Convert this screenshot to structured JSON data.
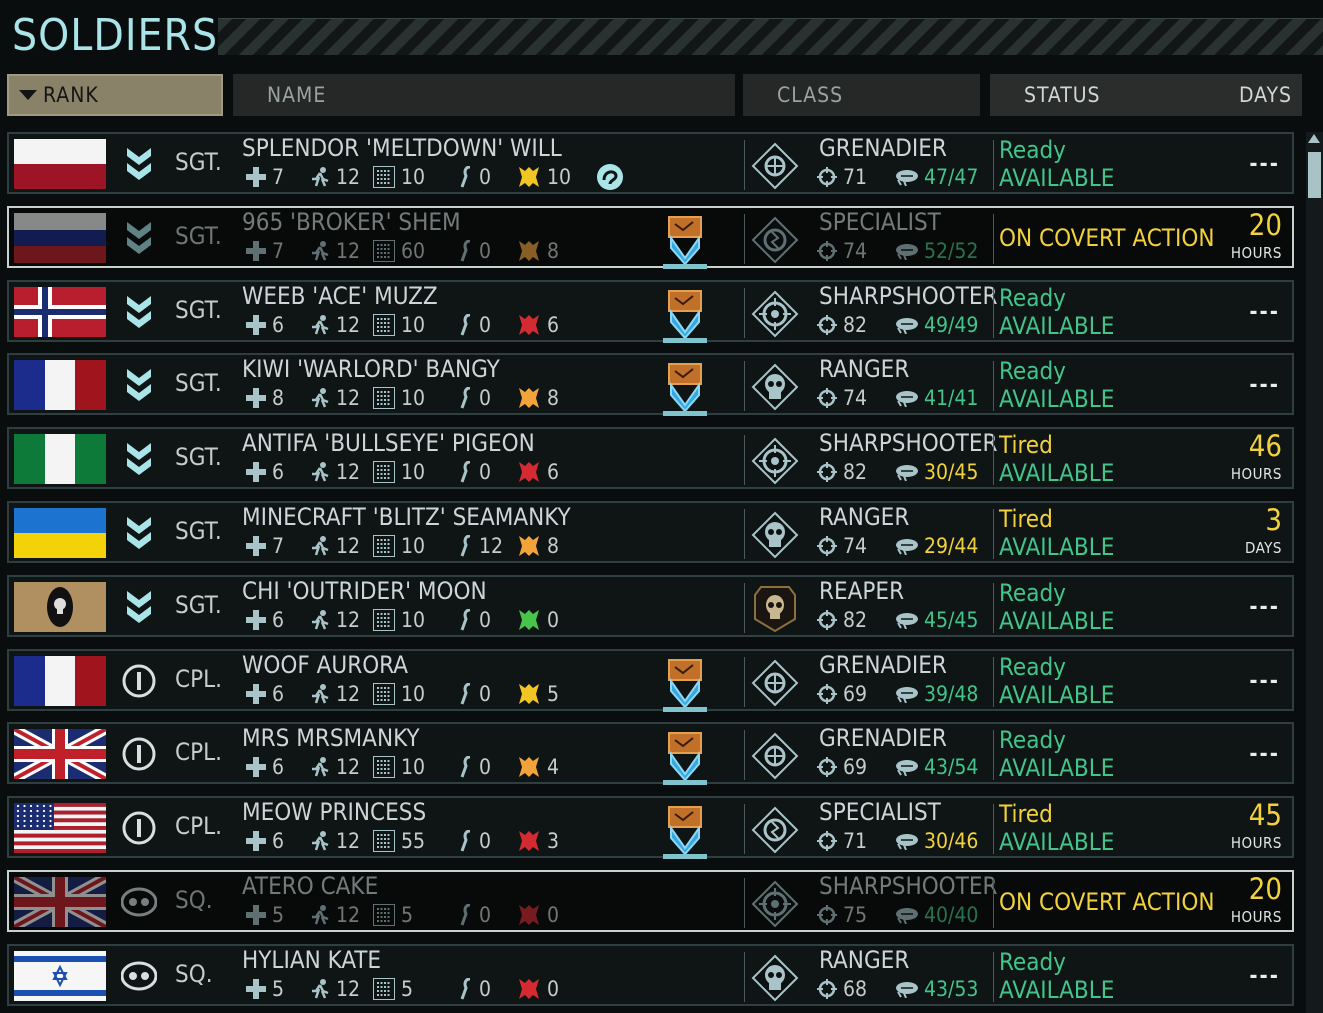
{
  "screen": {
    "title": "SOLDIERS",
    "columns": {
      "rank": "RANK",
      "name": "NAME",
      "class": "CLASS",
      "status": "STATUS",
      "days": "DAYS"
    }
  },
  "colors": {
    "ready": "#42c48a",
    "tired": "#f2d23a",
    "accent": "#a8e4e8"
  },
  "soldiers": [
    {
      "flag": "poland",
      "rank_icon": "sergeant-chevron-icon",
      "rank": "SGT.",
      "name": "SPLENDOR 'MELTDOWN' WILL",
      "hp": "7",
      "mobility": "12",
      "hack": "10",
      "psi": "0",
      "bond_color": "yellow",
      "bond": "10",
      "extra_icon": "ability-icon",
      "class_icon": "grenadier-icon",
      "class": "GRENADIER",
      "aim": "71",
      "will": "47/47",
      "will_color": "green",
      "status1": "Ready",
      "status1_color": "ready",
      "status2": "AVAILABLE",
      "days": "---",
      "covert": false,
      "dim": false,
      "badge": false
    },
    {
      "flag": "russia",
      "rank_icon": "sergeant-chevron-icon",
      "rank": "SGT.",
      "name": "965 'BROKER' SHEM",
      "hp": "7",
      "mobility": "12",
      "hack": "60",
      "psi": "0",
      "bond_color": "orange",
      "bond": "8",
      "class_icon": "specialist-icon",
      "class": "SPECIALIST",
      "aim": "74",
      "will": "52/52",
      "will_color": "green",
      "status1": "ON COVERT ACTION",
      "days_num": "20",
      "days_unit": "HOURS",
      "covert": true,
      "dim": true,
      "badge": true
    },
    {
      "flag": "norway",
      "rank_icon": "sergeant-chevron-icon",
      "rank": "SGT.",
      "name": "WEEB 'ACE' MUZZ",
      "hp": "6",
      "mobility": "12",
      "hack": "10",
      "psi": "0",
      "bond_color": "red",
      "bond": "6",
      "class_icon": "sharpshooter-icon",
      "class": "SHARPSHOOTER",
      "aim": "82",
      "will": "49/49",
      "will_color": "green",
      "status1": "Ready",
      "status1_color": "ready",
      "status2": "AVAILABLE",
      "days": "---",
      "covert": false,
      "dim": false,
      "badge": true
    },
    {
      "flag": "france",
      "rank_icon": "sergeant-chevron-icon",
      "rank": "SGT.",
      "name": "KIWI 'WARLORD' BANGY",
      "hp": "8",
      "mobility": "12",
      "hack": "10",
      "psi": "0",
      "bond_color": "orange",
      "bond": "8",
      "class_icon": "ranger-icon",
      "class": "RANGER",
      "aim": "74",
      "will": "41/41",
      "will_color": "green",
      "status1": "Ready",
      "status1_color": "ready",
      "status2": "AVAILABLE",
      "days": "---",
      "covert": false,
      "dim": false,
      "badge": true
    },
    {
      "flag": "nigeria",
      "rank_icon": "sergeant-chevron-icon",
      "rank": "SGT.",
      "name": "ANTIFA 'BULLSEYE' PIGEON",
      "hp": "6",
      "mobility": "12",
      "hack": "10",
      "psi": "0",
      "bond_color": "red",
      "bond": "6",
      "class_icon": "sharpshooter-icon",
      "class": "SHARPSHOOTER",
      "aim": "82",
      "will": "30/45",
      "will_color": "yellow",
      "status1": "Tired",
      "status1_color": "tired",
      "status2": "AVAILABLE",
      "days_num": "46",
      "days_unit": "HOURS",
      "covert": false,
      "dim": false,
      "badge": false
    },
    {
      "flag": "ukraine",
      "rank_icon": "sergeant-chevron-icon",
      "rank": "SGT.",
      "name": "MINECRAFT 'BLITZ' SEAMANKY",
      "hp": "7",
      "mobility": "12",
      "hack": "10",
      "psi": "12",
      "bond_color": "orange",
      "bond": "8",
      "class_icon": "ranger-icon",
      "class": "RANGER",
      "aim": "74",
      "will": "29/44",
      "will_color": "yellow",
      "status1": "Tired",
      "status1_color": "tired",
      "status2": "AVAILABLE",
      "days_num": "3",
      "days_unit": "DAYS",
      "covert": false,
      "dim": false,
      "badge": false
    },
    {
      "flag": "reaper",
      "rank_icon": "sergeant-chevron-icon",
      "rank": "SGT.",
      "name": "CHI 'OUTRIDER' MOON",
      "hp": "6",
      "mobility": "12",
      "hack": "10",
      "psi": "0",
      "bond_color": "green",
      "bond": "0",
      "class_icon": "reaper-skull-icon",
      "class": "REAPER",
      "aim": "82",
      "will": "45/45",
      "will_color": "green",
      "status1": "Ready",
      "status1_color": "ready",
      "status2": "AVAILABLE",
      "days": "---",
      "covert": false,
      "dim": false,
      "badge": false
    },
    {
      "flag": "france",
      "rank_icon": "corporal-bar-icon",
      "rank": "CPL.",
      "name": "WOOF AURORA",
      "hp": "6",
      "mobility": "12",
      "hack": "10",
      "psi": "0",
      "bond_color": "yellow",
      "bond": "5",
      "class_icon": "grenadier-icon",
      "class": "GRENADIER",
      "aim": "69",
      "will": "39/48",
      "will_color": "green",
      "status1": "Ready",
      "status1_color": "ready",
      "status2": "AVAILABLE",
      "days": "---",
      "covert": false,
      "dim": false,
      "badge": true
    },
    {
      "flag": "uk",
      "rank_icon": "corporal-bar-icon",
      "rank": "CPL.",
      "name": "MRS MRSMANKY",
      "hp": "6",
      "mobility": "12",
      "hack": "10",
      "psi": "0",
      "bond_color": "orange",
      "bond": "4",
      "class_icon": "grenadier-icon",
      "class": "GRENADIER",
      "aim": "69",
      "will": "43/54",
      "will_color": "green",
      "status1": "Ready",
      "status1_color": "ready",
      "status2": "AVAILABLE",
      "days": "---",
      "covert": false,
      "dim": false,
      "badge": true
    },
    {
      "flag": "usa",
      "rank_icon": "corporal-bar-icon",
      "rank": "CPL.",
      "name": "MEOW PRINCESS",
      "hp": "6",
      "mobility": "12",
      "hack": "55",
      "psi": "0",
      "bond_color": "red",
      "bond": "3",
      "class_icon": "specialist-icon",
      "class": "SPECIALIST",
      "aim": "71",
      "will": "30/46",
      "will_color": "yellow",
      "status1": "Tired",
      "status1_color": "tired",
      "status2": "AVAILABLE",
      "days_num": "45",
      "days_unit": "HOURS",
      "covert": false,
      "dim": false,
      "badge": true
    },
    {
      "flag": "uk",
      "rank_icon": "squaddie-dots-icon",
      "rank": "SQ.",
      "name": "ATERO CAKE",
      "hp": "5",
      "mobility": "12",
      "hack": "5",
      "psi": "0",
      "bond_color": "red",
      "bond": "0",
      "class_icon": "sharpshooter-icon",
      "class": "SHARPSHOOTER",
      "aim": "75",
      "will": "40/40",
      "will_color": "green",
      "status1": "ON COVERT ACTION",
      "days_num": "20",
      "days_unit": "HOURS",
      "covert": true,
      "dim": true,
      "badge": false
    },
    {
      "flag": "israel",
      "rank_icon": "squaddie-dots-icon",
      "rank": "SQ.",
      "name": "HYLIAN KATE",
      "hp": "5",
      "mobility": "12",
      "hack": "5",
      "psi": "0",
      "bond_color": "red",
      "bond": "0",
      "class_icon": "ranger-icon",
      "class": "RANGER",
      "aim": "68",
      "will": "43/53",
      "will_color": "green",
      "status1": "Ready",
      "status1_color": "ready",
      "status2": "AVAILABLE",
      "days": "---",
      "covert": false,
      "dim": false,
      "badge": false
    }
  ]
}
